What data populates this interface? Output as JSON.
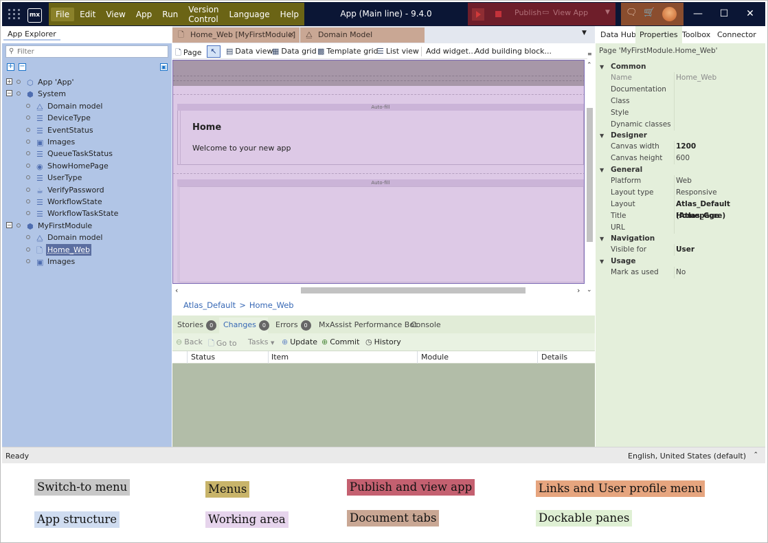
{
  "titlebar": {
    "logo": "mx",
    "menus": [
      "File",
      "Edit",
      "View",
      "App",
      "Run",
      "Version Control",
      "Language",
      "Help"
    ],
    "app_title": "App (Main line)  -  9.4.0",
    "publish_label": "Publish",
    "view_app_label": "View App",
    "window_buttons": [
      "minimize",
      "maximize",
      "close"
    ]
  },
  "app_explorer": {
    "title": "App Explorer",
    "filter_placeholder": "Filter",
    "tree": [
      {
        "label": "App 'App'",
        "icon": "app-icon"
      },
      {
        "label": "System",
        "icon": "module-icon"
      },
      {
        "label": "Domain model",
        "icon": "domain-model-icon"
      },
      {
        "label": "DeviceType",
        "icon": "enumeration-icon"
      },
      {
        "label": "EventStatus",
        "icon": "enumeration-icon"
      },
      {
        "label": "Images",
        "icon": "images-icon"
      },
      {
        "label": "QueueTaskStatus",
        "icon": "enumeration-icon"
      },
      {
        "label": "ShowHomePage",
        "icon": "microflow-icon"
      },
      {
        "label": "UserType",
        "icon": "enumeration-icon"
      },
      {
        "label": "VerifyPassword",
        "icon": "java-action-icon"
      },
      {
        "label": "WorkflowState",
        "icon": "enumeration-icon"
      },
      {
        "label": "WorkflowTaskState",
        "icon": "enumeration-icon"
      },
      {
        "label": "MyFirstModule",
        "icon": "module-icon"
      },
      {
        "label": "Domain model",
        "icon": "domain-model-icon"
      },
      {
        "label": "Home_Web",
        "icon": "page-icon"
      },
      {
        "label": "Images",
        "icon": "images-icon"
      }
    ]
  },
  "doc_tabs": [
    {
      "label": "Home_Web [MyFirstModule]",
      "icon": "page-icon"
    },
    {
      "label": "Domain Model [MyFirstModule]",
      "icon": "domain-model-icon"
    }
  ],
  "toolbar": [
    "Page",
    "Data view",
    "Data grid",
    "Template grid",
    "List view",
    "Add widget...",
    "Add building block..."
  ],
  "canvas": {
    "autofill_label": "Auto-fill",
    "heading": "Home",
    "welcome": "Welcome to your new app"
  },
  "breadcrumb": [
    "Atlas_Default",
    "Home_Web"
  ],
  "bottom_tabs": [
    {
      "label": "Stories",
      "count": "0"
    },
    {
      "label": "Changes",
      "count": "0"
    },
    {
      "label": "Errors",
      "count": "0"
    },
    {
      "label": "MxAssist Performance Bot"
    },
    {
      "label": "Console"
    }
  ],
  "bottom_toolbar": [
    "Back",
    "Go to",
    "Tasks",
    "Update",
    "Commit",
    "History"
  ],
  "changes_columns": [
    "Status",
    "Item",
    "Module",
    "Details"
  ],
  "right_tabs": [
    "Data Hub",
    "Properties",
    "Toolbox",
    "Connector"
  ],
  "properties": {
    "path": "Page 'MyFirstModule.Home_Web'",
    "sections": {
      "common": "Common",
      "designer": "Designer",
      "general": "General",
      "navigation": "Navigation",
      "usage": "Usage"
    },
    "rows": {
      "name": {
        "key": "Name",
        "value": "Home_Web"
      },
      "documentation": {
        "key": "Documentation",
        "value": ""
      },
      "class": {
        "key": "Class",
        "value": ""
      },
      "style": {
        "key": "Style",
        "value": ""
      },
      "dynamic_classes": {
        "key": "Dynamic classes",
        "value": ""
      },
      "canvas_width": {
        "key": "Canvas width",
        "value": "1200"
      },
      "canvas_height": {
        "key": "Canvas height",
        "value": "600"
      },
      "platform": {
        "key": "Platform",
        "value": "Web"
      },
      "layout_type": {
        "key": "Layout type",
        "value": "Responsive"
      },
      "layout": {
        "key": "Layout",
        "value": "Atlas_Default (Atlas_Core)"
      },
      "title": {
        "key": "Title",
        "value": "Homepage"
      },
      "url": {
        "key": "URL",
        "value": ""
      },
      "visible_for": {
        "key": "Visible for",
        "value": "User"
      },
      "mark_as_used": {
        "key": "Mark as used",
        "value": "No"
      }
    }
  },
  "statusbar": {
    "left": "Ready",
    "right": "English, United States (default)"
  },
  "legend": {
    "switch_to_menu": "Switch-to menu",
    "menus": "Menus",
    "publish_and_view_app": "Publish and view app",
    "links_and_user_profile_menu": "Links and User profile menu",
    "app_structure": "App structure",
    "working_area": "Working area",
    "document_tabs": "Document tabs",
    "dockable_panes": "Dockable panes"
  },
  "colors": {
    "switch_to_menu": "#c8c8c8",
    "menus": "#c8b46a",
    "publish": "#c46070",
    "links_profile": "#e6a57f",
    "app_structure": "#cfdcf0",
    "working_area": "#e6d4ec",
    "document_tabs": "#c9a794",
    "dockable_panes": "#dff0d4"
  }
}
